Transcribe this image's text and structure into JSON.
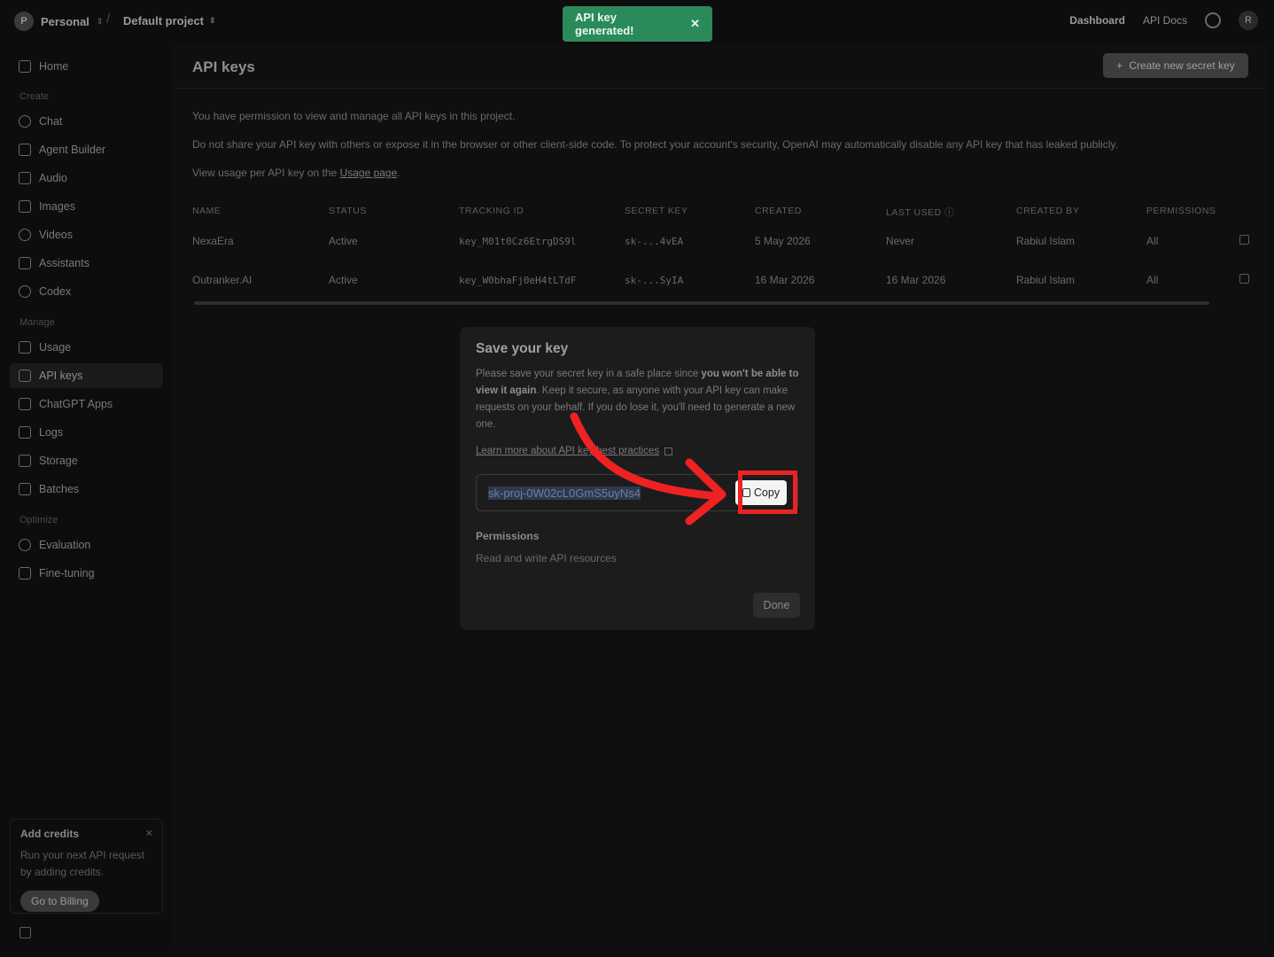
{
  "topbar": {
    "org_initial": "P",
    "org_name": "Personal",
    "project_name": "Default project",
    "toast_text": "API key generated!",
    "links": [
      "Dashboard",
      "API Docs"
    ],
    "user_initial": "R"
  },
  "sidebar": {
    "home": "Home",
    "section_create": "Create",
    "create_items": [
      "Chat",
      "Agent Builder",
      "Audio",
      "Images",
      "Videos",
      "Assistants",
      "Codex"
    ],
    "section_manage": "Manage",
    "manage_items": [
      "Usage",
      "API keys",
      "ChatGPT Apps",
      "Logs",
      "Storage",
      "Batches"
    ],
    "section_optimize": "Optimize",
    "optimize_items": [
      "Evaluation",
      "Fine-tuning"
    ],
    "credits": {
      "title": "Add credits",
      "desc": "Run your next API request by adding credits.",
      "button": "Go to Billing"
    }
  },
  "main": {
    "title": "API keys",
    "create_button": "Create new secret key",
    "info1": "You have permission to view and manage all API keys in this project.",
    "info2": "Do not share your API key with others or expose it in the browser or other client-side code. To protect your account's security, OpenAI may automatically disable any API key that has leaked publicly.",
    "info3_prefix": "View usage per API key on the ",
    "info3_link": "Usage page",
    "info3_suffix": ".",
    "table": {
      "headers": [
        "NAME",
        "STATUS",
        "TRACKING ID",
        "SECRET KEY",
        "CREATED",
        "LAST USED",
        "CREATED BY",
        "PERMISSIONS"
      ],
      "rows": [
        [
          "NexaEra",
          "Active",
          "key_M01t0Cz6EtrgDS9l",
          "sk-...4vEA",
          "5 May 2026",
          "Never",
          "Rabiul Islam",
          "All"
        ],
        [
          "Outranker.AI",
          "Active",
          "key_W0bhaFj0eH4tLTdF",
          "sk-...SyIA",
          "16 Mar 2026",
          "16 Mar 2026",
          "Rabiul Islam",
          "All"
        ]
      ]
    }
  },
  "modal": {
    "title": "Save your key",
    "desc_a": "Please save your secret key in a safe place since ",
    "desc_bold": "you won't be able to view it again",
    "desc_b": ". Keep it secure, as anyone with your API key can make requests on your behalf. If you do lose it, you'll need to generate a new one.",
    "link": "Learn more about API key best practices",
    "key_value": "sk-proj-0W02cL0GmS5uyNs4",
    "copy_label": "Copy",
    "permissions_label": "Permissions",
    "permissions_value": "Read and write API resources",
    "done_label": "Done"
  },
  "colors": {
    "toast": "#2b8a5a",
    "annotation": "#ee2222"
  }
}
